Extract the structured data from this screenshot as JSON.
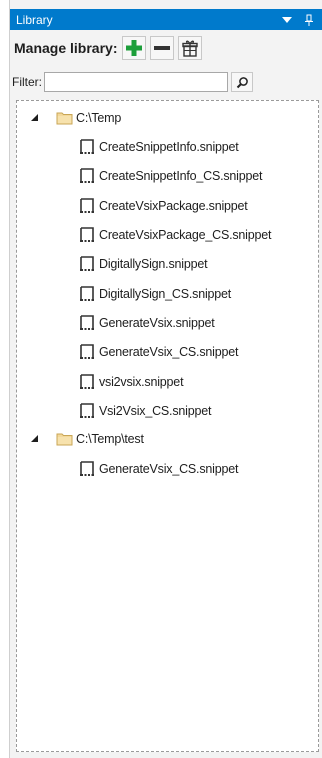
{
  "panel": {
    "title": "Library",
    "icons": [
      "dropdown-arrow-icon",
      "pin-icon"
    ]
  },
  "toolbar": {
    "manage_label": "Manage library:",
    "buttons": [
      "add-icon",
      "remove-icon",
      "package-icon"
    ],
    "colors": {
      "add": "#1c9e3a",
      "remove": "#333333",
      "titlebar": "#007acc"
    }
  },
  "filter": {
    "label": "Filter:",
    "value": "",
    "button_icon": "search-icon"
  },
  "tree": {
    "folders": [
      {
        "label": "C:\\Temp",
        "expanded": true,
        "files": [
          "CreateSnippetInfo.snippet",
          "CreateSnippetInfo_CS.snippet",
          "CreateVsixPackage.snippet",
          "CreateVsixPackage_CS.snippet",
          "DigitallySign.snippet",
          "DigitallySign_CS.snippet",
          "GenerateVsix.snippet",
          "GenerateVsix_CS.snippet",
          "vsi2vsix.snippet",
          "Vsi2Vsix_CS.snippet"
        ]
      },
      {
        "label": "C:\\Temp\\test",
        "expanded": true,
        "files": [
          "GenerateVsix_CS.snippet"
        ]
      }
    ]
  }
}
